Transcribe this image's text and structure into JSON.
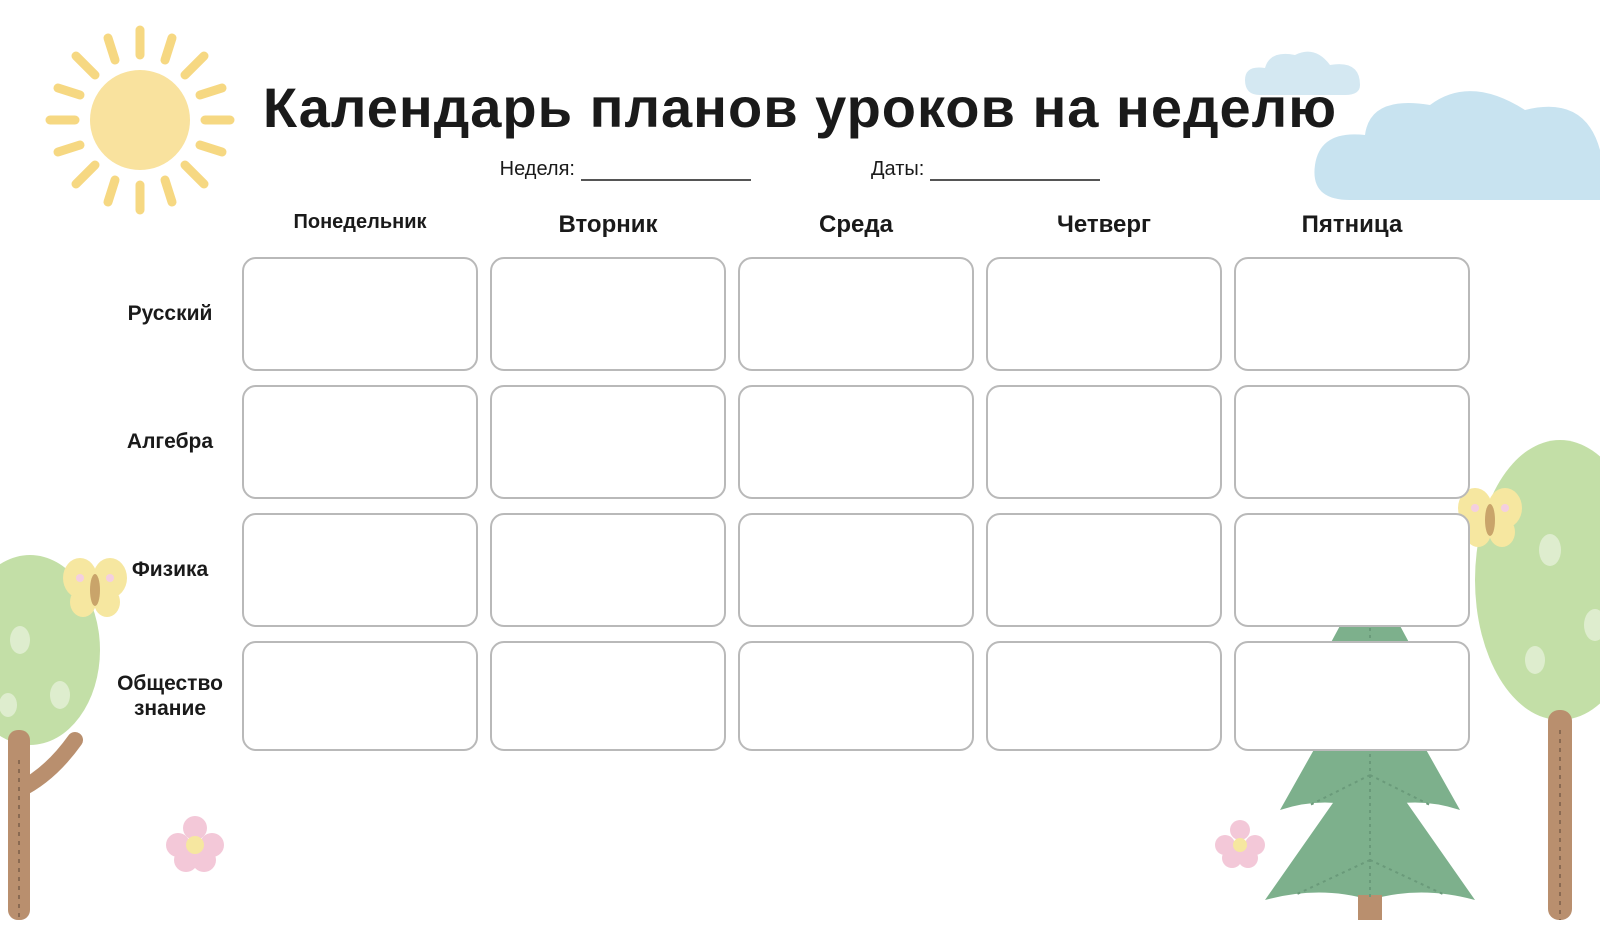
{
  "title": "Календарь планов уроков на неделю",
  "meta": {
    "week_label": "Неделя:",
    "dates_label": "Даты:"
  },
  "days": [
    "Понедельник",
    "Вторник",
    "Среда",
    "Четверг",
    "Пятница"
  ],
  "subjects": [
    "Русский",
    "Алгебра",
    "Физика",
    "Общество\nзнание"
  ],
  "colors": {
    "sun": "#f9e29e",
    "sun_ray": "#f6d882",
    "cloud_big": "#c8e3f0",
    "cloud_small": "#d4e8f2",
    "tree_green_light": "#c3dfa7",
    "tree_green_dark": "#8fbf8a",
    "tree_trunk": "#b98f6e",
    "pine": "#7db08c",
    "butterfly": "#f6e7a0",
    "butterfly_pink": "#f4cfe0",
    "flower_pink": "#f3c8d8",
    "flower_center": "#f6e7a0"
  }
}
